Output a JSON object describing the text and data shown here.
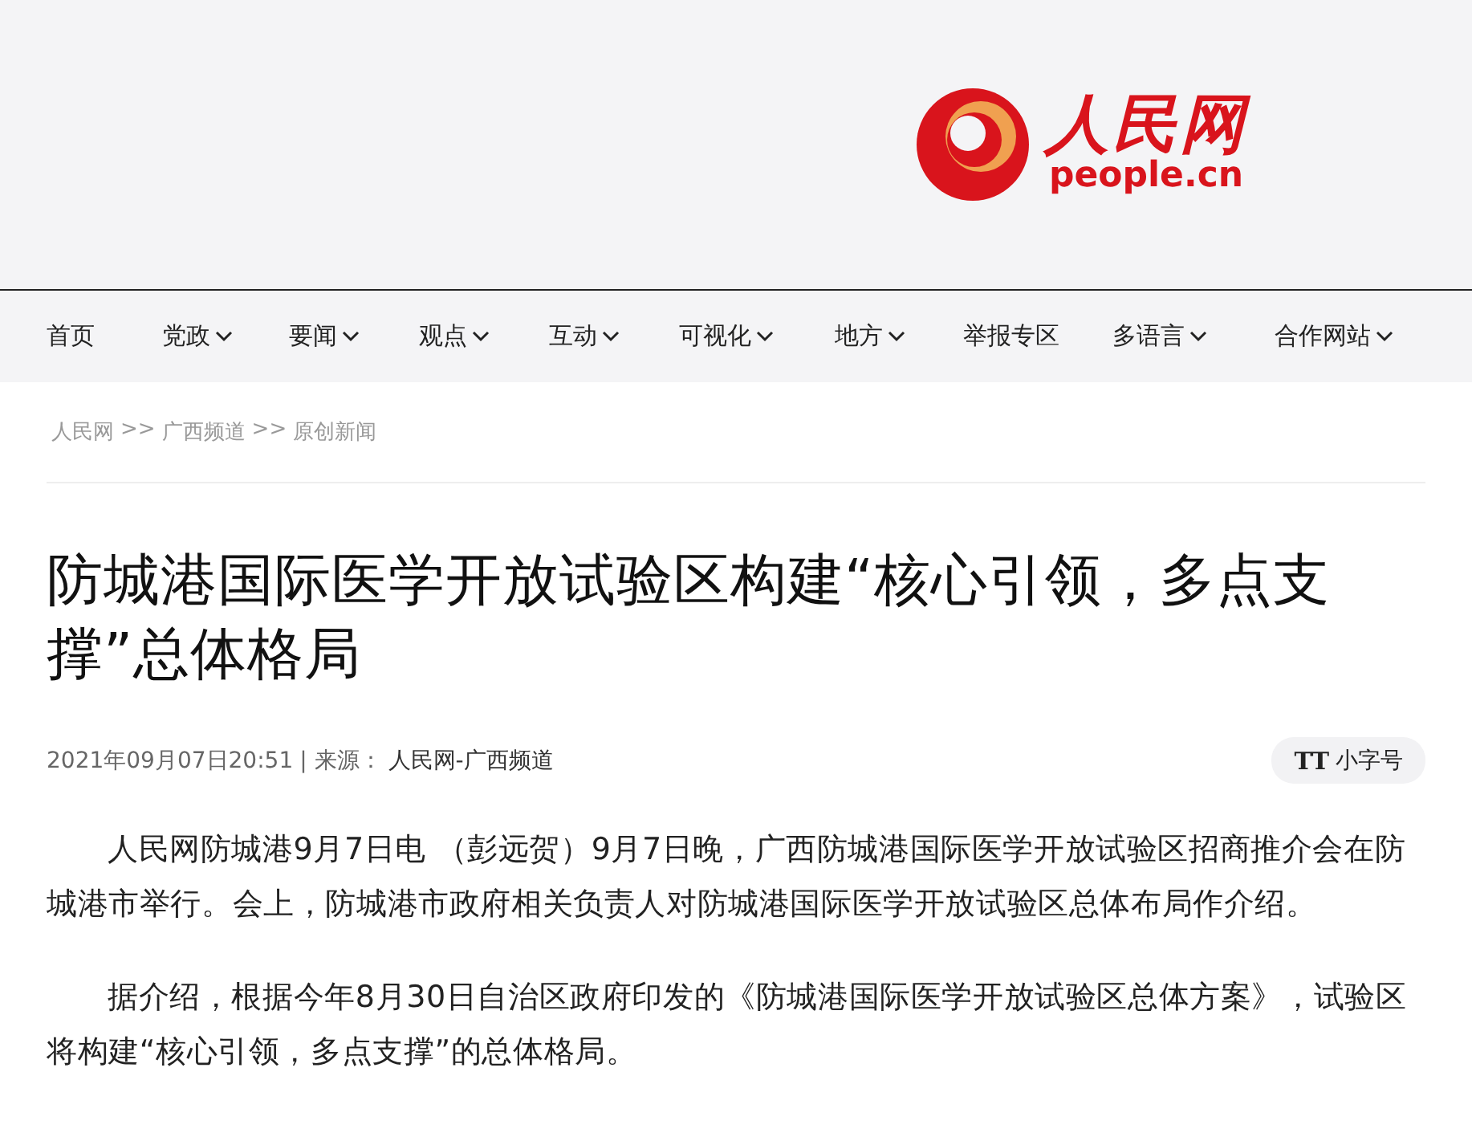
{
  "logo": {
    "title": "人民网",
    "domain": "people.cn"
  },
  "nav": [
    {
      "label": "首页",
      "dropdown": false
    },
    {
      "label": "党政",
      "dropdown": true
    },
    {
      "label": "要闻",
      "dropdown": true
    },
    {
      "label": "观点",
      "dropdown": true
    },
    {
      "label": "互动",
      "dropdown": true
    },
    {
      "label": "可视化",
      "dropdown": true
    },
    {
      "label": "地方",
      "dropdown": true
    },
    {
      "label": "举报专区",
      "dropdown": false
    },
    {
      "label": "多语言",
      "dropdown": true
    },
    {
      "label": "合作网站",
      "dropdown": true
    }
  ],
  "breadcrumb": [
    "人民网",
    "广西频道",
    "原创新闻"
  ],
  "breadcrumb_separator": ">>",
  "article": {
    "title": "防城港国际医学开放试验区构建“核心引领，多点支撑”总体格局",
    "date": "2021年09月07日20:51",
    "source_label": "| 来源：",
    "source": "人民网-广西频道",
    "font_button": {
      "icon": "TT",
      "label": "小字号"
    },
    "paragraphs": [
      "人民网防城港9月7日电 （彭远贺）9月7日晚，广西防城港国际医学开放试验区招商推介会在防城港市举行。会上，防城港市政府相关负责人对防城港国际医学开放试验区总体布局作介绍。",
      "据介绍，根据今年8月30日自治区政府印发的《防城港国际医学开放试验区总体方案》，试验区将构建“核心引领，多点支撑”的总体格局。"
    ]
  }
}
